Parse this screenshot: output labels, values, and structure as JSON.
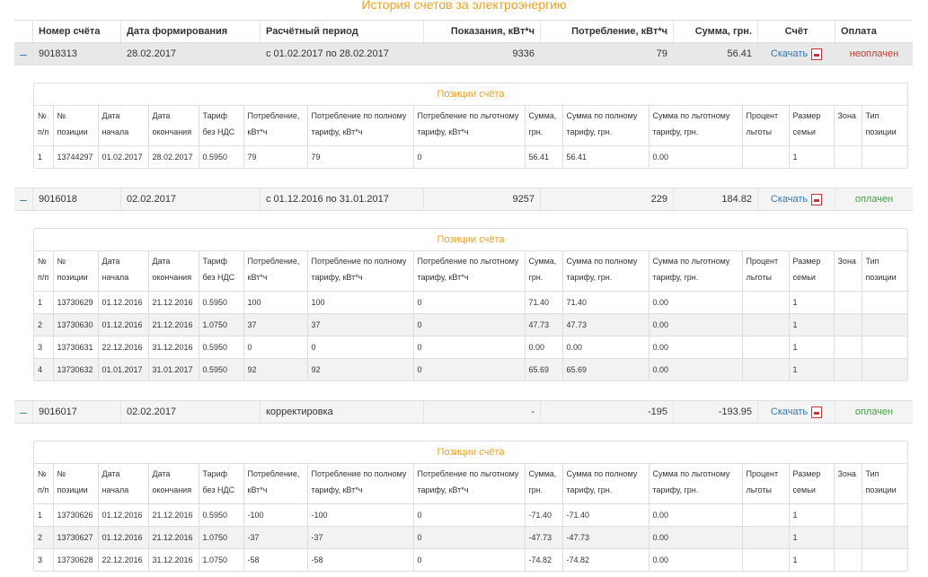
{
  "page_title": "История счетов за электроэнергию",
  "headers": {
    "account": "Номер счёта",
    "date": "Дата формирования",
    "period": "Расчётный период",
    "readings": "Показания, кВт*ч",
    "consumption": "Потребление, кВт*ч",
    "sum": "Сумма, грн.",
    "invoice": "Счёт",
    "payment": "Оплата"
  },
  "download_label": "Скачать",
  "positions_title": "Позиции счёта",
  "pos_headers": [
    "№ п/п",
    "№ позиции",
    "Дата начала",
    "Дата окончания",
    "Тариф без НДС",
    "Потребление, кВт*ч",
    "Потребление по полному тарифу, кВт*ч",
    "Потребление по льготному тарифу, кВт*ч",
    "Сумма, грн.",
    "Сумма по полному тарифу, грн.",
    "Сумма по льготному тарифу, грн.",
    "Процент льготы",
    "Размер семьи",
    "Зона",
    "Тип позиции"
  ],
  "bills": [
    {
      "toggle": "–",
      "account": "9018313",
      "date": "28.02.2017",
      "period": "с 01.02.2017 по 28.02.2017",
      "readings": "9336",
      "consumption": "79",
      "sum": "56.41",
      "payment": "неоплачен",
      "status": "unpaid",
      "positions": [
        [
          "1",
          "13744297",
          "01.02.2017",
          "28.02.2017",
          "0.5950",
          "79",
          "79",
          "0",
          "56.41",
          "56.41",
          "0.00",
          "",
          "1",
          "",
          ""
        ]
      ]
    },
    {
      "toggle": "–",
      "account": "9016018",
      "date": "02.02.2017",
      "period": "с 01.12.2016 по 31.01.2017",
      "readings": "9257",
      "consumption": "229",
      "sum": "184.82",
      "payment": "оплачен",
      "status": "paid",
      "positions": [
        [
          "1",
          "13730629",
          "01.12.2016",
          "21.12.2016",
          "0.5950",
          "100",
          "100",
          "0",
          "71.40",
          "71.40",
          "0.00",
          "",
          "1",
          "",
          ""
        ],
        [
          "2",
          "13730630",
          "01.12.2016",
          "21.12.2016",
          "1.0750",
          "37",
          "37",
          "0",
          "47.73",
          "47.73",
          "0.00",
          "",
          "1",
          "",
          ""
        ],
        [
          "3",
          "13730631",
          "22.12.2016",
          "31.12.2016",
          "0.5950",
          "0",
          "0",
          "0",
          "0.00",
          "0.00",
          "0.00",
          "",
          "1",
          "",
          ""
        ],
        [
          "4",
          "13730632",
          "01.01.2017",
          "31.01.2017",
          "0.5950",
          "92",
          "92",
          "0",
          "65.69",
          "65.69",
          "0.00",
          "",
          "1",
          "",
          ""
        ]
      ]
    },
    {
      "toggle": "–",
      "account": "9016017",
      "date": "02.02.2017",
      "period": "корректировка",
      "readings": "-",
      "consumption": "-195",
      "sum": "-193.95",
      "payment": "оплачен",
      "status": "paid",
      "positions": [
        [
          "1",
          "13730626",
          "01.12.2016",
          "21.12.2016",
          "0.5950",
          "-100",
          "-100",
          "0",
          "-71.40",
          "-71.40",
          "0.00",
          "",
          "1",
          "",
          ""
        ],
        [
          "2",
          "13730627",
          "01.12.2016",
          "21.12.2016",
          "1.0750",
          "-37",
          "-37",
          "0",
          "-47.73",
          "-47.73",
          "0.00",
          "",
          "1",
          "",
          ""
        ],
        [
          "3",
          "13730628",
          "22.12.2016",
          "31.12.2016",
          "1.0750",
          "-58",
          "-58",
          "0",
          "-74.82",
          "-74.82",
          "0.00",
          "",
          "1",
          "",
          ""
        ]
      ]
    }
  ],
  "colors": {
    "accent": "#f0a020",
    "link": "#2a7ab8",
    "unpaid": "#c0392b",
    "paid": "#3aa63a"
  }
}
